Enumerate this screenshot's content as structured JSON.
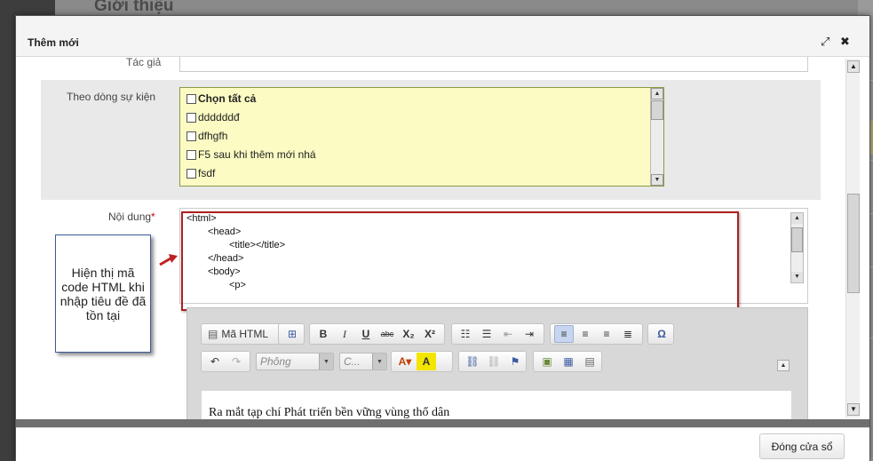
{
  "background": {
    "heading": "Giới thiệu"
  },
  "modal": {
    "title": "Thêm mới",
    "maximize_icon": "⤢",
    "close_icon": "✖",
    "footer": {
      "close_window_label": "Đóng cửa sổ"
    }
  },
  "form": {
    "author_label": "Tác giả",
    "events_label": "Theo dòng sự kiện",
    "events": [
      "Chọn tất cả",
      "ddddddđ",
      "dfhgfh",
      "F5 sau khi thêm mới nhá",
      "fsdf"
    ],
    "content_label": "Nội dung",
    "required_mark": "*"
  },
  "source": {
    "lines": [
      "<html>",
      "<head>",
      "<title></title>",
      "</head>",
      "<body>",
      "<p>"
    ]
  },
  "callout": {
    "text": "Hiện thị mã code HTML khi nhập tiêu đề đã tồn tại"
  },
  "toolbar": {
    "html_source_label": "Mã HTML",
    "bold": "B",
    "italic": "I",
    "underline": "U",
    "strike": "abc",
    "subscript": "X₂",
    "superscript": "X²",
    "font_placeholder": "Phông",
    "size_placeholder": "C...",
    "omega": "Ω"
  },
  "editor": {
    "content_text": "Ra mắt tạp chí Phát triển bền vững vùng thổ dân"
  },
  "colors": {
    "accent_red": "#b02020",
    "event_bg": "#fbfbc3",
    "callout_border": "#3c5a9a"
  }
}
